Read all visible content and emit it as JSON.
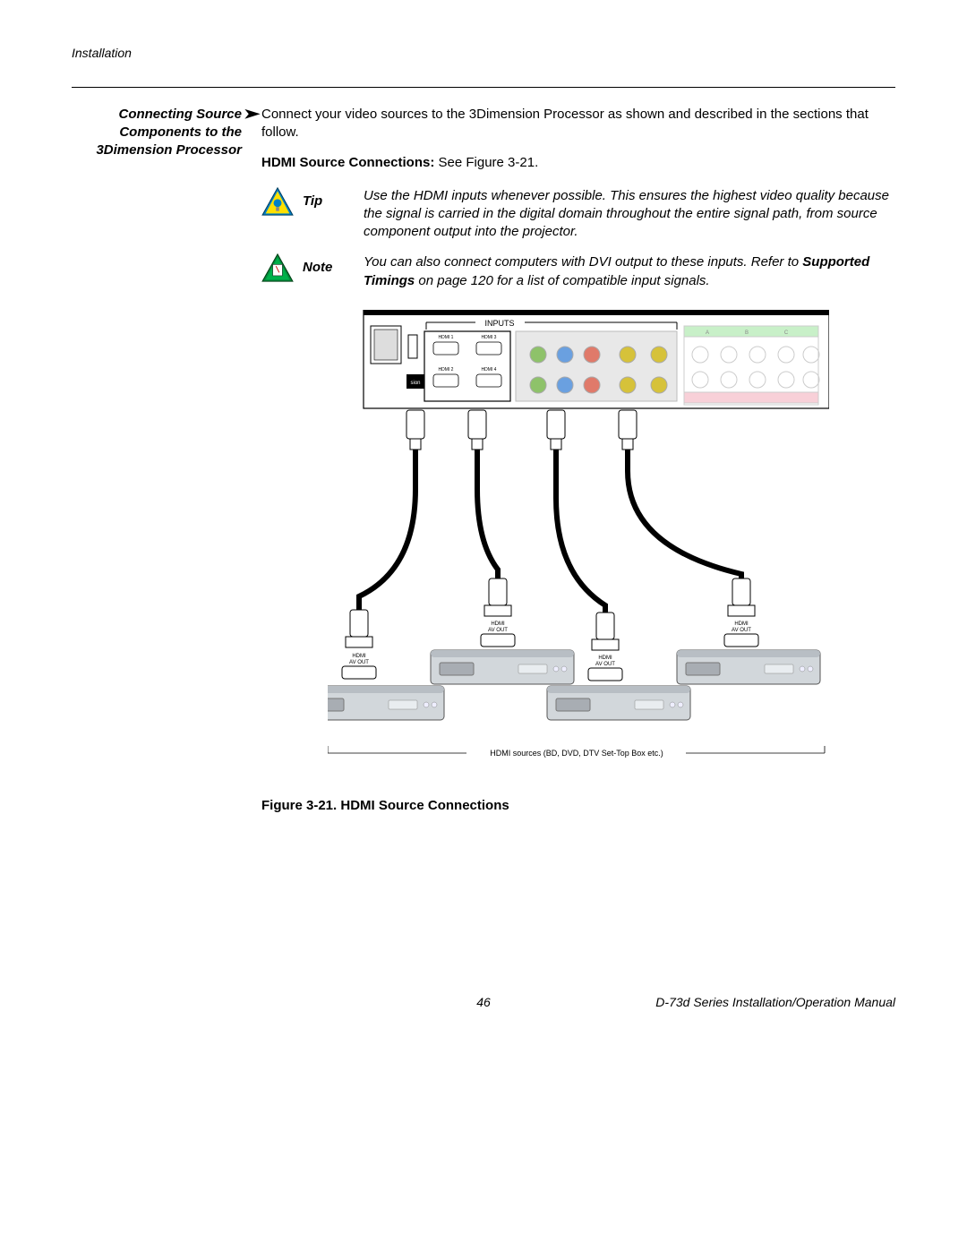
{
  "header": {
    "section": "Installation"
  },
  "sidebar": {
    "heading": "Connecting Source Components to the 3Dimension Processor"
  },
  "main": {
    "intro": "Connect your video sources to the 3Dimension Processor as shown and described in the sections that follow.",
    "subhead_bold": "HDMI Source Connections: ",
    "subhead_rest": "See Figure 3-21.",
    "tip_label": "Tip",
    "tip_text": "Use the HDMI inputs whenever possible. This ensures the highest video quality because the signal is carried in the digital domain throughout the entire signal path, from source component output into the projector.",
    "note_label": "Note",
    "note_text_pre": "You can also connect computers with DVI output to these inputs. Refer to ",
    "note_text_bold": "Supported Timings",
    "note_text_post": " on page 120 for a list of compatible input signals."
  },
  "figure": {
    "panel_label": "INPUTS",
    "hdmi_ports": [
      "HDMI 1",
      "HDMI 3",
      "HDMI 2",
      "HDMI 4"
    ],
    "group_labels": [
      "A",
      "B",
      "C"
    ],
    "port_out_label_top": "HDMI",
    "port_out_label_bottom": "AV OUT",
    "sources_caption": "HDMI sources (BD, DVD, DTV Set-Top Box etc.)",
    "caption": "Figure 3-21. HDMI Source Connections"
  },
  "footer": {
    "page": "46",
    "manual": "D-73d Series Installation/Operation Manual"
  }
}
